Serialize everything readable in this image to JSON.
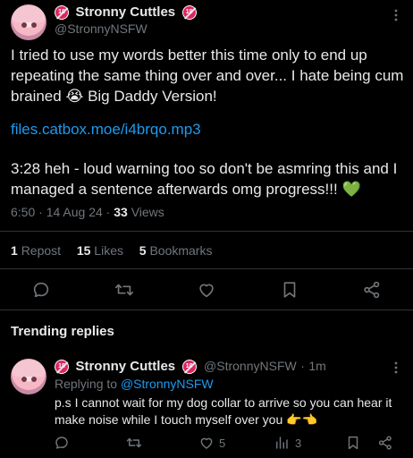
{
  "post": {
    "author_name": "Stronny Cuttles",
    "author_handle": "@StronnyNSFW",
    "badge_label": "18",
    "text_line1": "I tried to use my words better this time only to end up",
    "text_line2": "repeating the same thing over and over... I hate being cum",
    "text_line3_a": "brained",
    "text_line3_emoji": "😭",
    "text_line3_b": "Big Daddy Version!",
    "link": "files.catbox.moe/i4brqo.mp3",
    "text_line5": "3:28 heh - loud warning too so don't be asmring this and I",
    "text_line6": "managed a sentence afterwards omg progress!!!",
    "text_line6_emoji": "💚",
    "time": "6:50",
    "date": "14 Aug 24",
    "views_count": "33",
    "views_label": "Views",
    "reposts_count": "1",
    "reposts_label": "Repost",
    "likes_count": "15",
    "likes_label": "Likes",
    "bookmarks_count": "5",
    "bookmarks_label": "Bookmarks"
  },
  "trending": {
    "heading": "Trending replies"
  },
  "reply": {
    "author_name": "Stronny Cuttles",
    "author_handle": "@StronnyNSFW",
    "time_ago": "1m",
    "replying_prefix": "Replying to",
    "replying_handle": "@StronnyNSFW",
    "text_line1": "p.s I cannot wait for my dog collar to arrive so you can hear it",
    "text_line2": "make noise while I touch myself over you",
    "text_emoji": "👉👈",
    "likes": "5",
    "views": "3"
  },
  "colors": {
    "background": "#000000",
    "text": "#e7e9ea",
    "muted": "#71767b",
    "link": "#1d9bf0",
    "divider": "#2f3336",
    "heart_green": "#5fd35f"
  }
}
